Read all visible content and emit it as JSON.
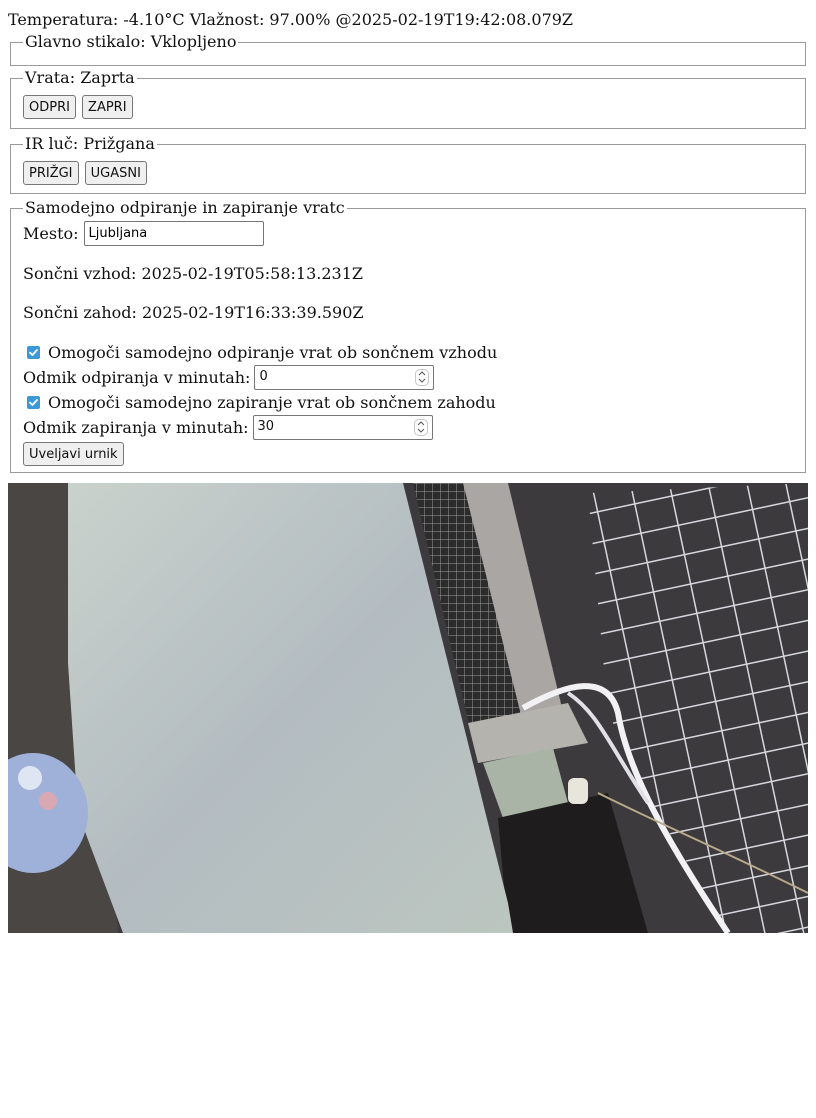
{
  "status": {
    "text": "Temperatura: -4.10°C Vlažnost: 97.00% @2025-02-19T19:42:08.079Z"
  },
  "main_switch": {
    "legend": "Glavno stikalo: Vklopljeno"
  },
  "door": {
    "legend": "Vrata: Zaprta",
    "open_label": "ODPRI",
    "close_label": "ZAPRI"
  },
  "ir_light": {
    "legend": "IR luč: Prižgana",
    "on_label": "PRIŽGI",
    "off_label": "UGASNI"
  },
  "auto": {
    "legend": "Samodejno odpiranje in zapiranje vratc",
    "city_label": "Mesto:",
    "city_value": "Ljubljana",
    "sunrise_text": "Sončni vzhod: 2025-02-19T05:58:13.231Z",
    "sunset_text": "Sončni zahod: 2025-02-19T16:33:39.590Z",
    "enable_open_label": "Omogoči samodejno odpiranje vrat ob sončnem vzhodu",
    "enable_open_checked": true,
    "open_offset_label": "Odmik odpiranja v minutah:",
    "open_offset_value": "0",
    "enable_close_label": "Omogoči samodejno zapiranje vrat ob sončnem zahodu",
    "enable_close_checked": true,
    "close_offset_label": "Odmik zapiranja v minutah:",
    "close_offset_value": "30",
    "apply_label": "Uveljavi urnik"
  },
  "colors": {
    "checkbox_accent": "#3b99d8",
    "fieldset_border": "#9a9a9a",
    "button_bg": "#efefef"
  }
}
